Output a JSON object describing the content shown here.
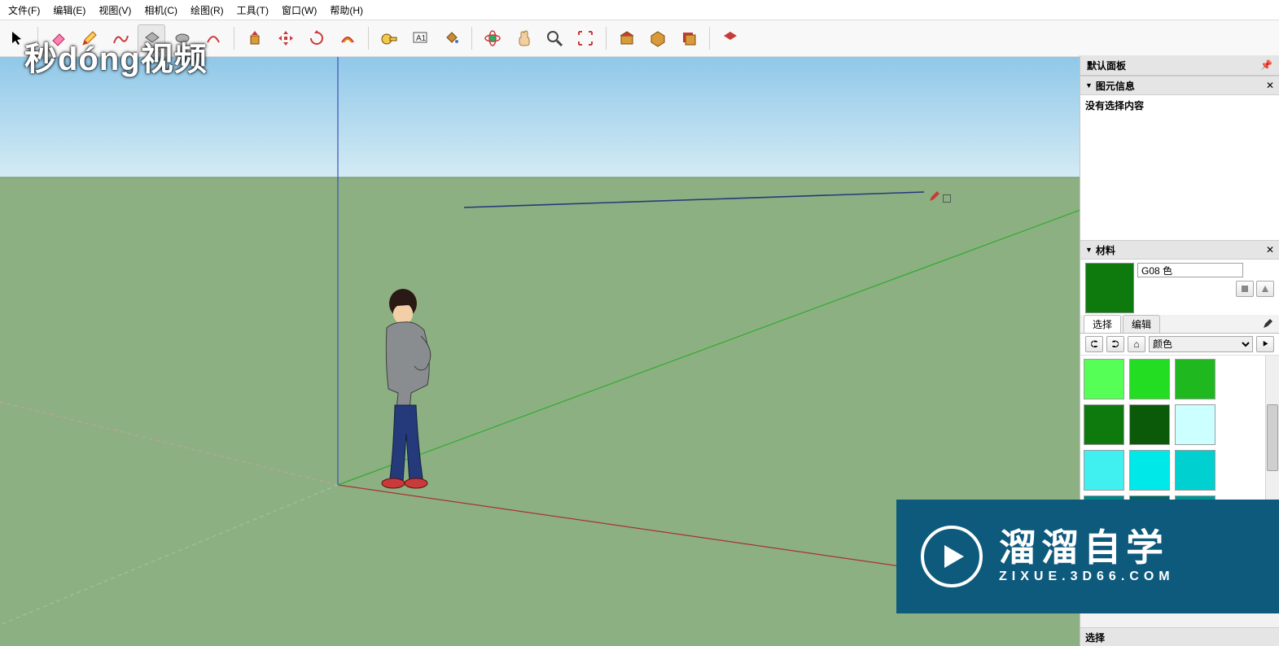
{
  "menu": {
    "file": "文件(F)",
    "edit": "编辑(E)",
    "view": "视图(V)",
    "camera": "相机(C)",
    "draw": "绘图(R)",
    "tools": "工具(T)",
    "window": "窗口(W)",
    "help": "帮助(H)"
  },
  "tray": {
    "title": "默认面板",
    "entity_info": {
      "header": "图元信息",
      "body": "没有选择内容"
    },
    "materials": {
      "header": "材料",
      "name": "G08 色",
      "tabs": {
        "select": "选择",
        "edit": "编辑"
      },
      "listLabel": "颜色",
      "swatches": [
        "#55ff55",
        "#22dd22",
        "#1fb81f",
        "#0e7a0e",
        "#0a5a0a",
        "#ccffff",
        "#40f0f0",
        "#00e8e8",
        "#00d0d0",
        "#008888",
        "#006666",
        "#009797"
      ]
    },
    "select_panel": {
      "header": "选择"
    }
  },
  "watermarks": {
    "top": "秒dóng视频",
    "bottom_big": "溜溜自学",
    "bottom_small": "ZIXUE.3D66.COM"
  }
}
